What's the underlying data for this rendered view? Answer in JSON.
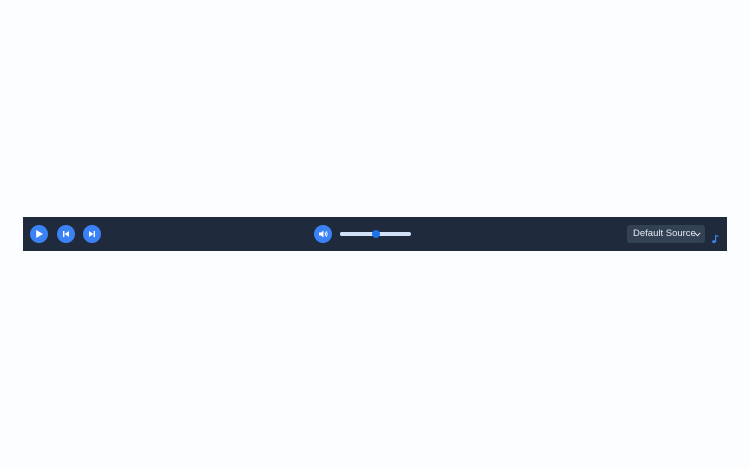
{
  "player": {
    "controls": {
      "play_icon": "play-icon",
      "previous_icon": "skip-previous-icon",
      "next_icon": "skip-next-icon",
      "volume_icon": "volume-icon"
    },
    "volume": {
      "level_fraction": 0.5
    },
    "source": {
      "selected": "Default Source"
    },
    "indicator_icon": "music-note-icon"
  },
  "colors": {
    "bar_background": "#1f2a3c",
    "button_accent": "#3b82f6",
    "slider_track": "#cfe0f7",
    "slider_thumb": "#1a73e8",
    "select_background": "#334155",
    "music_icon": "#3b82f6"
  }
}
